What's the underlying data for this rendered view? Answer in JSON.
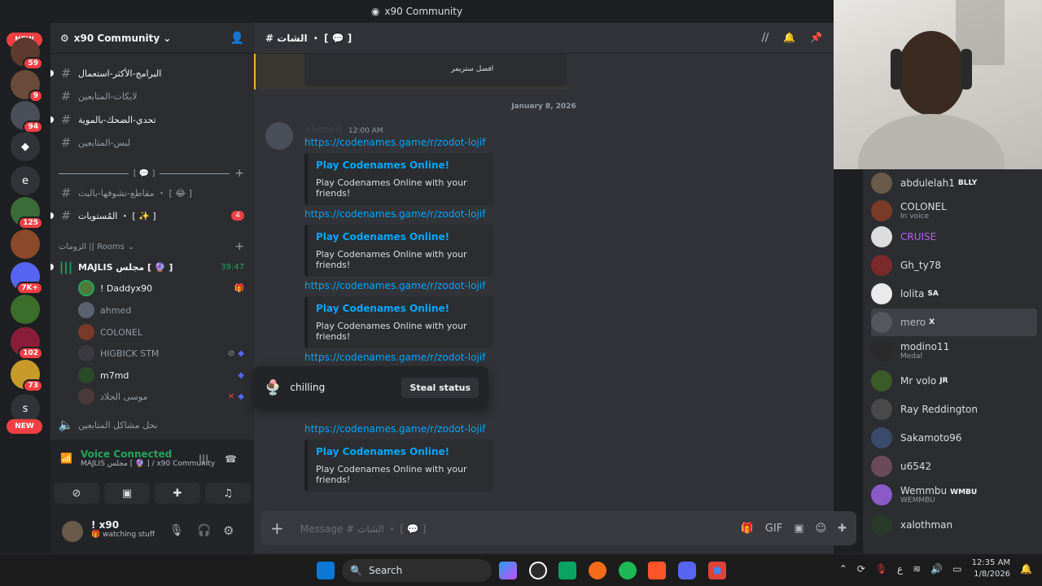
{
  "title": "x90 Community",
  "new_label": "NEW",
  "server_letters": [
    "e",
    "s"
  ],
  "server_badges": [
    "59",
    "9",
    "94",
    "125",
    "7K+",
    "102",
    "73"
  ],
  "guild": {
    "name": "x90 Community"
  },
  "channels": [
    {
      "name": "البرامج-الأكثر-استعمال",
      "unread": true
    },
    {
      "name": "لايكات-المتابعين",
      "unread": false
    },
    {
      "name": "تحدي-الضحك-بالموية",
      "unread": true
    },
    {
      "name": "لبس-المتابعين",
      "unread": false
    }
  ],
  "category1": "[ 💬 ]",
  "channels2": [
    {
      "name": "مقاطع-نشوفها-بالبث ・ [ 😂 ]",
      "unread": false
    },
    {
      "name": "المُستويات ・ [ ✨ ]",
      "unread": true,
      "badge": "4"
    }
  ],
  "rooms_label": "الزومات || Rooms",
  "voice_channel": {
    "name": "MAJLIS مجلس [ 🔮 ]",
    "time": "39:47"
  },
  "voice_users": [
    {
      "name": "! Daddyx90",
      "hl": true
    },
    {
      "name": "ahmed",
      "hl": false
    },
    {
      "name": "COLONEL",
      "hl": false
    },
    {
      "name": "HIGBICK STM",
      "hl": false
    },
    {
      "name": "m7md",
      "hl": true
    },
    {
      "name": "موسى الجلاد",
      "hl": false
    }
  ],
  "muted_channel": "نحل مشاكل المتابعين",
  "voice_status": {
    "label": "Voice Connected",
    "location": "MAJLIS مجلس [ 🔮 ] / x90 Community"
  },
  "user": {
    "name": "! x90",
    "status": "watching stuff"
  },
  "channel_header": "# الشات ・ [ 💬 ]",
  "pinned_caption": "افضل ستريمر",
  "date_divider": "January 8, 2026",
  "message": {
    "author": "ahmed",
    "time": "12:00 AM"
  },
  "links": [
    "https://codenames.game/r/zodot-lojif",
    "https://codenames.game/r/zodot-lojif",
    "https://codenames.game/r/zodot-lojif",
    "https://codenames.game/r/zodot-lojif",
    "https://codenames.game/r/zodot-lojif"
  ],
  "embed": {
    "title": "Play Codenames Online!",
    "desc": "Play Codenames Online with your friends!"
  },
  "popup": {
    "status": "chilling",
    "button": "Steal status"
  },
  "composer_placeholder": "Message # الشات ・ [ 💬 ]",
  "members": [
    {
      "name": "abdulelah1",
      "tag": "BLLY",
      "color": "#dbdee1"
    },
    {
      "name": "COLONEL",
      "sub": "In voice",
      "color": "#dbdee1"
    },
    {
      "name": "CRUISE",
      "color": "#c45cf2"
    },
    {
      "name": "Gh_ty78",
      "color": "#dbdee1"
    },
    {
      "name": "lolita",
      "tag": "SA",
      "color": "#dbdee1"
    },
    {
      "name": "mero",
      "tag": "X",
      "color": "#b5bac1"
    },
    {
      "name": "modino11",
      "sub": "Medal",
      "color": "#dbdee1"
    },
    {
      "name": "Mr volo",
      "tag": "JR",
      "color": "#dbdee1"
    },
    {
      "name": "Ray Reddington",
      "color": "#dbdee1"
    },
    {
      "name": "Sakamoto96",
      "color": "#dbdee1"
    },
    {
      "name": "u6542",
      "color": "#dbdee1"
    },
    {
      "name": "Wemmbu",
      "tag": "WMBU",
      "sub": "WEMMBU",
      "color": "#dbdee1"
    },
    {
      "name": "xalothman",
      "color": "#dbdee1"
    }
  ],
  "taskbar": {
    "search": "Search",
    "time": "12:35 AM",
    "date": "1/8/2026",
    "lang": "ع"
  }
}
